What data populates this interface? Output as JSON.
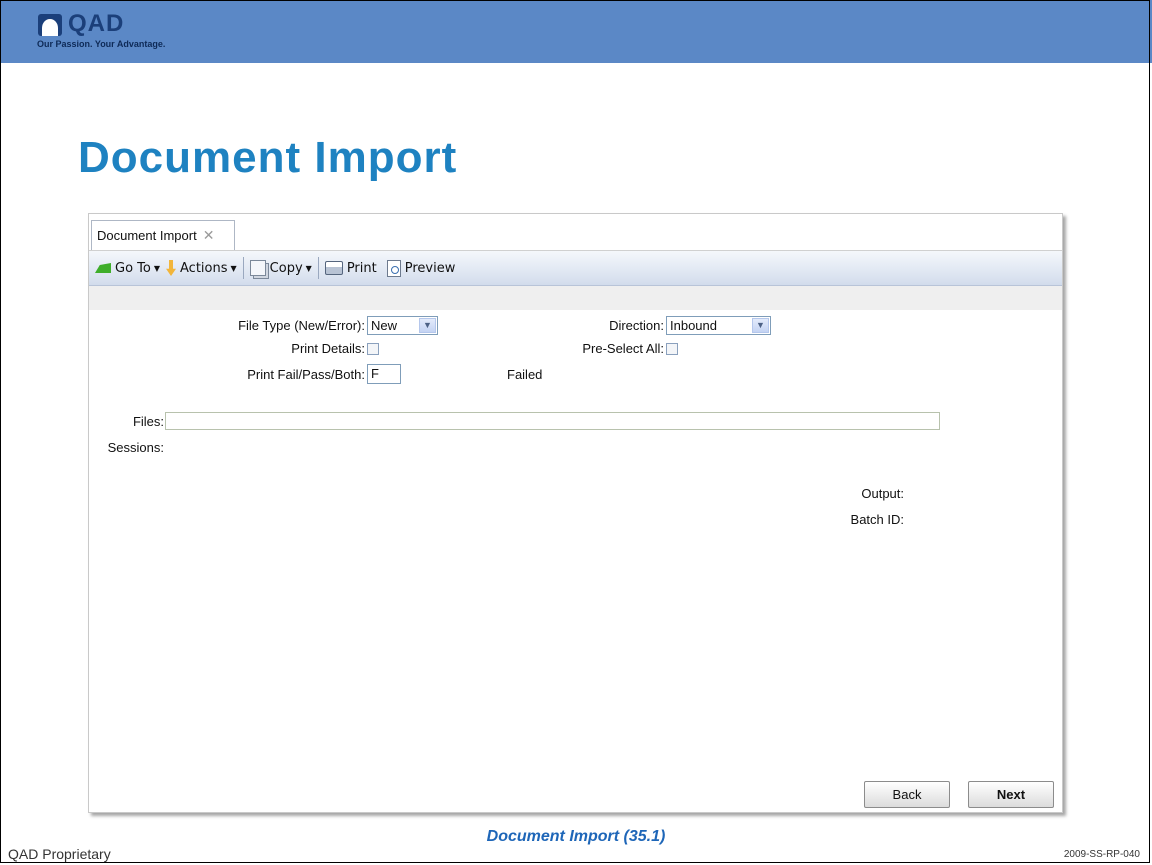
{
  "brand": {
    "logo_text": "QAD",
    "tagline": "Our Passion. Your Advantage."
  },
  "slide": {
    "title": "Document Import",
    "caption": "Document Import (35.1)",
    "footer_left": "QAD Proprietary",
    "footer_right": "2009-SS-RP-040"
  },
  "app": {
    "tab": {
      "label": "Document Import",
      "close": "✕"
    },
    "toolbar": {
      "goto": "Go To",
      "actions": "Actions",
      "copy": "Copy",
      "print": "Print",
      "preview": "Preview",
      "dropdown_arrow": "▼"
    },
    "form": {
      "file_type_label": "File Type (New/Error):",
      "file_type_value": "New",
      "direction_label": "Direction:",
      "direction_value": "Inbound",
      "print_details_label": "Print Details:",
      "pre_select_all_label": "Pre-Select All:",
      "print_fail_label": "Print Fail/Pass/Both:",
      "print_fail_value": "F",
      "print_fail_desc": "Failed",
      "files_label": "Files:",
      "sessions_label": "Sessions:",
      "output_label": "Output:",
      "batch_id_label": "Batch ID:"
    },
    "buttons": {
      "back": "Back",
      "next": "Next"
    }
  },
  "colors": {
    "header_band": "#5b88c6",
    "title": "#1e82c1",
    "caption": "#1e66b8"
  }
}
